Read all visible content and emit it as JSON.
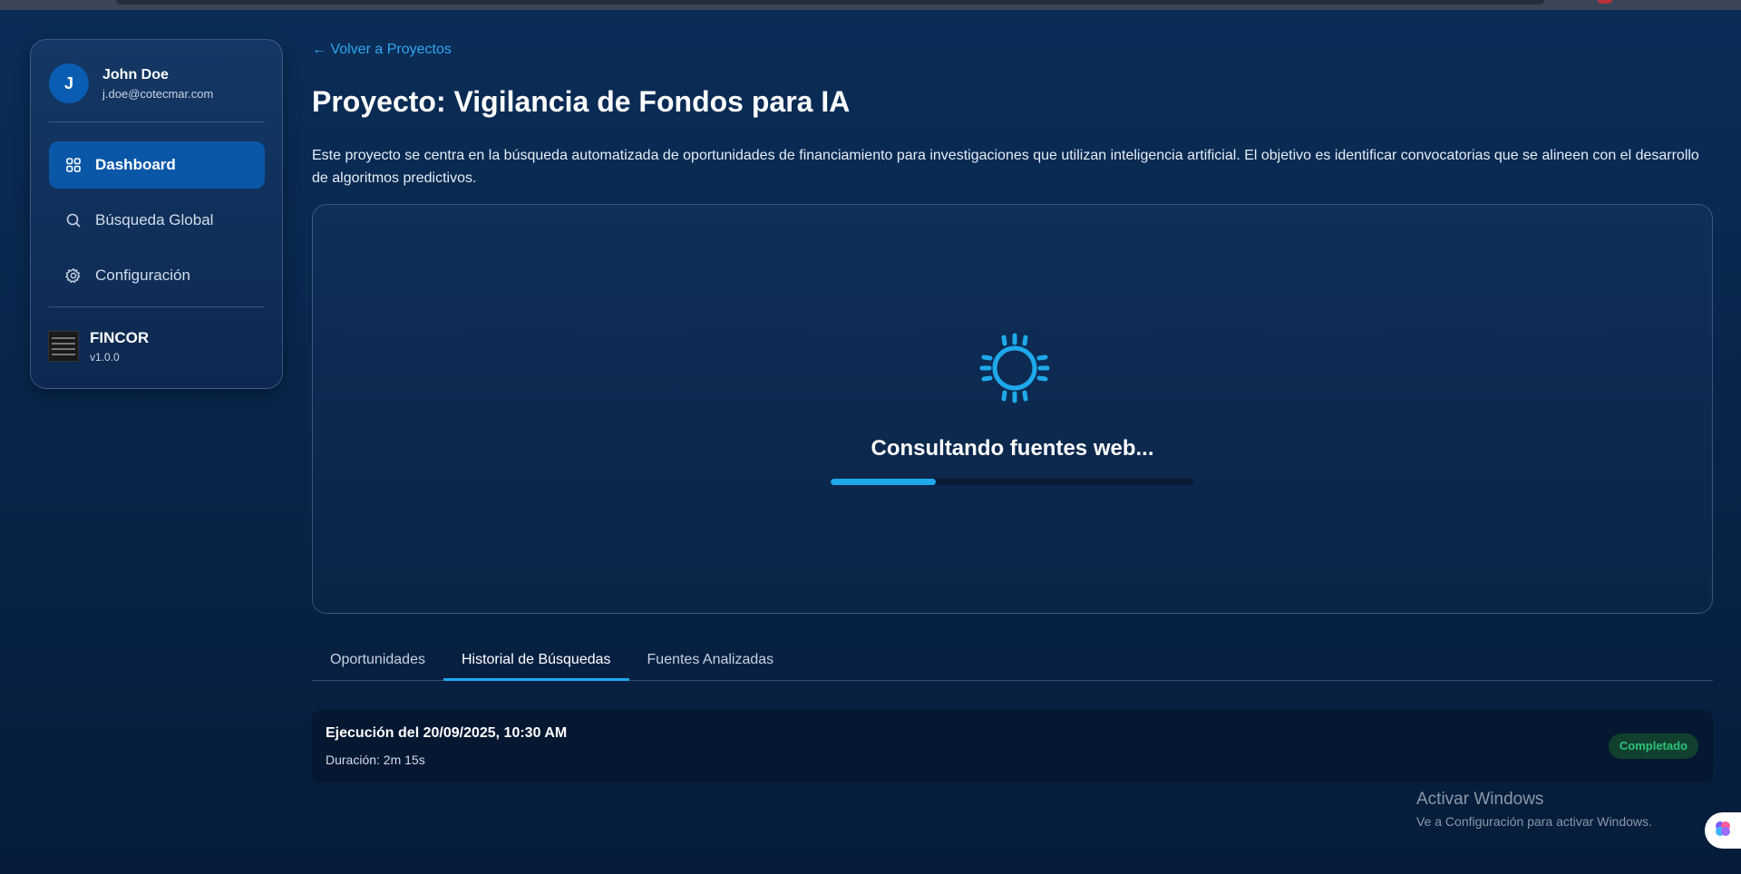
{
  "user": {
    "initial": "J",
    "name": "John Doe",
    "email": "j.doe@cotecmar.com"
  },
  "nav": [
    {
      "label": "Dashboard",
      "icon": "grid-icon",
      "active": true
    },
    {
      "label": "Búsqueda Global",
      "icon": "search-icon",
      "active": false
    },
    {
      "label": "Configuración",
      "icon": "gear-icon",
      "active": false
    }
  ],
  "brand": {
    "name": "FINCOR",
    "version": "v1.0.0"
  },
  "main": {
    "back_link": "← Volver a Proyectos",
    "title": "Proyecto: Vigilancia de Fondos para IA",
    "description": "Este proyecto se centra en la búsqueda automatizada de oportunidades de financiamiento para investigaciones que utilizan inteligencia artificial. El objetivo es identificar convocatorias que se alineen con el desarrollo de algoritmos predictivos."
  },
  "loading": {
    "text": "Consultando fuentes web...",
    "progress_percent": 29,
    "icon": "spinner-icon"
  },
  "tabs": [
    {
      "label": "Oportunidades",
      "active": false
    },
    {
      "label": "Historial de Búsquedas",
      "active": true
    },
    {
      "label": "Fuentes Analizadas",
      "active": false
    }
  ],
  "history": [
    {
      "title": "Ejecución del 20/09/2025, 10:30 AM",
      "duration": "Duración: 2m 15s",
      "status": "Completado"
    }
  ],
  "watermark": {
    "title": "Activar Windows",
    "subtitle": "Ve a Configuración para activar Windows."
  },
  "colors": {
    "accent": "#1ea9ea",
    "active_nav": "#0a57a8",
    "status_green": "#2ec17a",
    "background": "#082448"
  }
}
